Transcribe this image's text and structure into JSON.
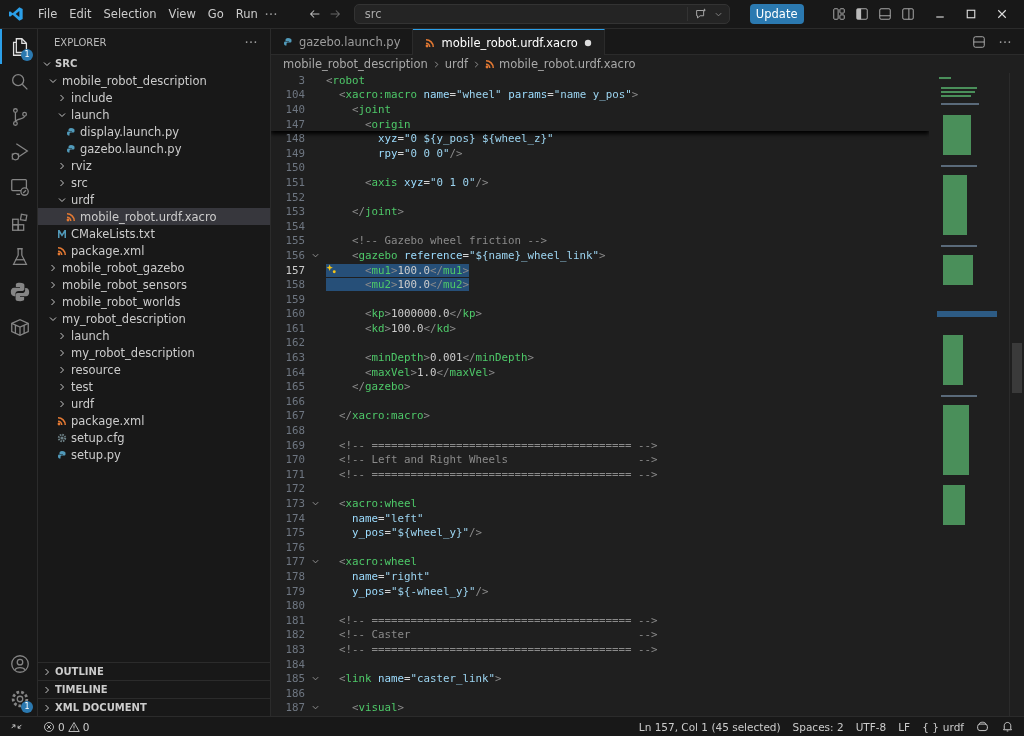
{
  "title_bar": {
    "menu": [
      "File",
      "Edit",
      "Selection",
      "View",
      "Go",
      "Run"
    ],
    "search": {
      "value": "src"
    },
    "update_button": "Update"
  },
  "activity_bar": {
    "top": [
      {
        "kind": "explorer",
        "selected": true,
        "badge": "1"
      },
      {
        "kind": "search",
        "selected": false
      },
      {
        "kind": "source-control",
        "selected": false
      },
      {
        "kind": "run-debug",
        "selected": false
      },
      {
        "kind": "remote",
        "selected": false
      },
      {
        "kind": "extensions",
        "selected": false
      },
      {
        "kind": "testing",
        "selected": false
      },
      {
        "kind": "python",
        "selected": false
      },
      {
        "kind": "container",
        "selected": false
      }
    ],
    "bottom": [
      {
        "kind": "account",
        "selected": false
      },
      {
        "kind": "settings",
        "selected": false,
        "badge": "1"
      }
    ]
  },
  "sidebar": {
    "title": "EXPLORER",
    "section": {
      "label": "SRC",
      "expanded": true
    },
    "tree": [
      {
        "label": "mobile_robot_description",
        "kind": "folder",
        "expanded": true,
        "selected": false,
        "children": [
          {
            "label": "include",
            "kind": "folder",
            "expanded": false,
            "selected": false
          },
          {
            "label": "launch",
            "kind": "folder",
            "expanded": true,
            "selected": false,
            "children": [
              {
                "label": "display.launch.py",
                "kind": "python",
                "selected": false
              },
              {
                "label": "gazebo.launch.py",
                "kind": "python",
                "selected": false
              }
            ]
          },
          {
            "label": "rviz",
            "kind": "folder",
            "expanded": false,
            "selected": false
          },
          {
            "label": "src",
            "kind": "folder",
            "expanded": false,
            "selected": false
          },
          {
            "label": "urdf",
            "kind": "folder",
            "expanded": true,
            "selected": false,
            "children": [
              {
                "label": "mobile_robot.urdf.xacro",
                "kind": "xml",
                "selected": true
              }
            ]
          },
          {
            "label": "CMakeLists.txt",
            "kind": "cmake",
            "selected": false
          },
          {
            "label": "package.xml",
            "kind": "xml",
            "selected": false
          }
        ]
      },
      {
        "label": "mobile_robot_gazebo",
        "kind": "folder",
        "expanded": false,
        "selected": false
      },
      {
        "label": "mobile_robot_sensors",
        "kind": "folder",
        "expanded": false,
        "selected": false
      },
      {
        "label": "mobile_robot_worlds",
        "kind": "folder",
        "expanded": false,
        "selected": false
      },
      {
        "label": "my_robot_description",
        "kind": "folder",
        "expanded": true,
        "selected": false,
        "children": [
          {
            "label": "launch",
            "kind": "folder",
            "expanded": false,
            "selected": false
          },
          {
            "label": "my_robot_description",
            "kind": "folder",
            "expanded": false,
            "selected": false
          },
          {
            "label": "resource",
            "kind": "folder",
            "expanded": false,
            "selected": false
          },
          {
            "label": "test",
            "kind": "folder",
            "expanded": false,
            "selected": false
          },
          {
            "label": "urdf",
            "kind": "folder",
            "expanded": false,
            "selected": false
          },
          {
            "label": "package.xml",
            "kind": "xml",
            "selected": false
          },
          {
            "label": "setup.cfg",
            "kind": "config",
            "selected": false
          },
          {
            "label": "setup.py",
            "kind": "python",
            "selected": false
          }
        ]
      }
    ],
    "panels": [
      {
        "label": "OUTLINE",
        "expanded": false
      },
      {
        "label": "TIMELINE",
        "expanded": false
      },
      {
        "label": "XML DOCUMENT",
        "expanded": false
      }
    ]
  },
  "tabs": [
    {
      "label": "gazebo.launch.py",
      "kind": "python",
      "selected": false,
      "modified": false
    },
    {
      "label": "mobile_robot.urdf.xacro",
      "kind": "xml",
      "selected": true,
      "modified": true
    }
  ],
  "breadcrumbs": [
    {
      "label": "mobile_robot_description",
      "kind": "folder"
    },
    {
      "label": "urdf",
      "kind": "folder"
    },
    {
      "label": "mobile_robot.urdf.xacro",
      "kind": "xml"
    }
  ],
  "sticky_lines": [
    {
      "number": "3",
      "text": "<robot"
    },
    {
      "number": "104",
      "text": "  <xacro:macro name=\"wheel\" params=\"name y_pos\">"
    },
    {
      "number": "140",
      "text": "    <joint"
    },
    {
      "number": "147",
      "text": "      <origin"
    }
  ],
  "code_lines": [
    {
      "number": "148",
      "text": "        xyz=\"0 ${y_pos} ${wheel_z}\""
    },
    {
      "number": "149",
      "text": "        rpy=\"0 0 0\"/>"
    },
    {
      "number": "150"
    },
    {
      "number": "151",
      "text": "      <axis xyz=\"0 1 0\"/>"
    },
    {
      "number": "152"
    },
    {
      "number": "153",
      "text": "    </joint>"
    },
    {
      "number": "154"
    },
    {
      "number": "155",
      "text": "    <!-- Gazebo wheel friction -->"
    },
    {
      "number": "156",
      "text": "    <gazebo reference=\"${name}_wheel_link\">",
      "fold": true
    },
    {
      "number": "157",
      "text": "      <mu1>100.0</mu1>",
      "selected": true,
      "current": true
    },
    {
      "number": "158",
      "text": "      <mu2>100.0</mu2>",
      "selected": true
    },
    {
      "number": "159"
    },
    {
      "number": "160",
      "text": "      <kp>1000000.0</kp>"
    },
    {
      "number": "161",
      "text": "      <kd>100.0</kd>"
    },
    {
      "number": "162"
    },
    {
      "number": "163",
      "text": "      <minDepth>0.001</minDepth>"
    },
    {
      "number": "164",
      "text": "      <maxVel>1.0</maxVel>"
    },
    {
      "number": "165",
      "text": "    </gazebo>"
    },
    {
      "number": "166"
    },
    {
      "number": "167",
      "text": "  </xacro:macro>"
    },
    {
      "number": "168"
    },
    {
      "number": "169",
      "text": "  <!-- ======================================== -->"
    },
    {
      "number": "170",
      "text": "  <!-- Left and Right Wheels                    -->"
    },
    {
      "number": "171",
      "text": "  <!-- ======================================== -->"
    },
    {
      "number": "172"
    },
    {
      "number": "173",
      "text": "  <xacro:wheel",
      "fold": true
    },
    {
      "number": "174",
      "text": "    name=\"left\""
    },
    {
      "number": "175",
      "text": "    y_pos=\"${wheel_y}\"/>"
    },
    {
      "number": "176"
    },
    {
      "number": "177",
      "text": "  <xacro:wheel",
      "fold": true
    },
    {
      "number": "178",
      "text": "    name=\"right\""
    },
    {
      "number": "179",
      "text": "    y_pos=\"${-wheel_y}\"/>"
    },
    {
      "number": "180"
    },
    {
      "number": "181",
      "text": "  <!-- ======================================== -->"
    },
    {
      "number": "182",
      "text": "  <!-- Caster                                   -->"
    },
    {
      "number": "183",
      "text": "  <!-- ======================================== -->"
    },
    {
      "number": "184"
    },
    {
      "number": "185",
      "text": "  <link name=\"caster_link\">",
      "fold": true
    },
    {
      "number": "186"
    },
    {
      "number": "187",
      "text": "    <visual>",
      "fold": true
    }
  ],
  "status_bar": {
    "errors": "0",
    "warnings": "0",
    "position": "Ln 157, Col 1 (45 selected)",
    "indent": "Spaces: 2",
    "encoding": "UTF-8",
    "eol": "LF",
    "language_icon": "{ }",
    "language": "urdf"
  }
}
